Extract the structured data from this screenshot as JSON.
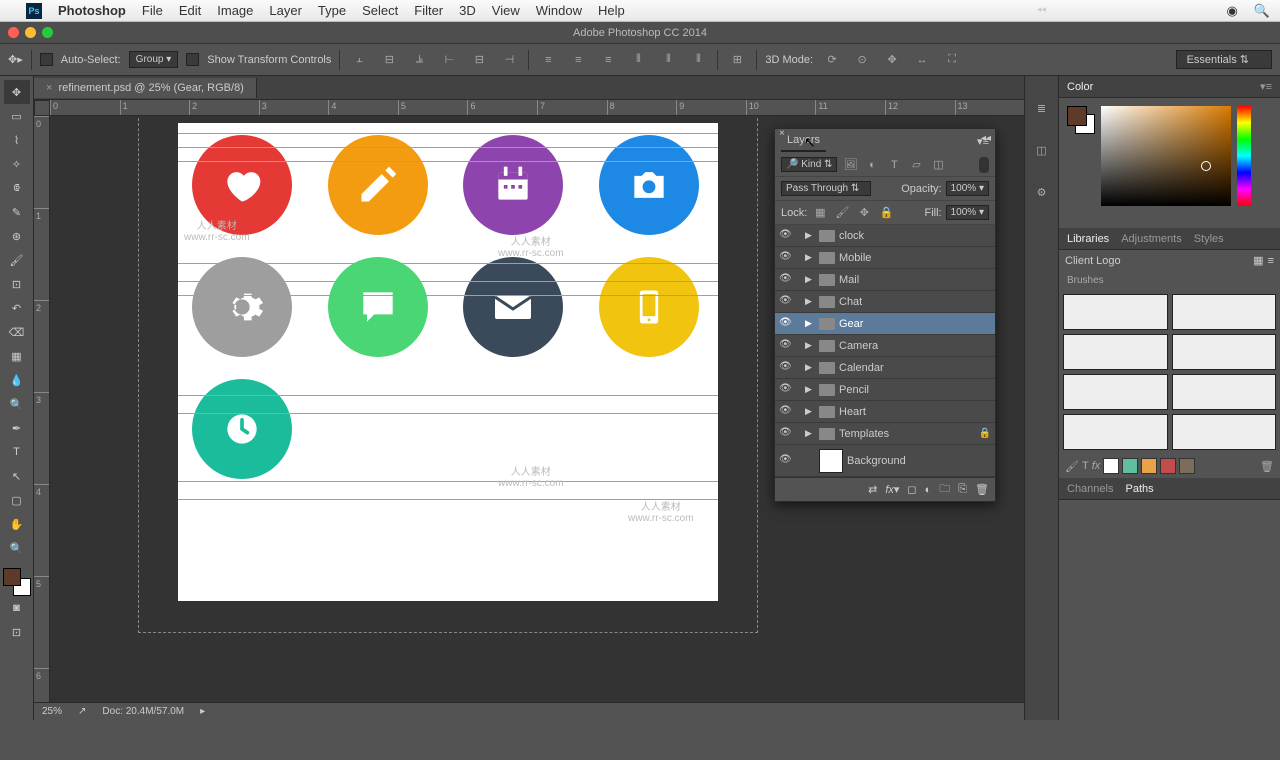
{
  "menubar": {
    "app": "Photoshop",
    "items": [
      "File",
      "Edit",
      "Image",
      "Layer",
      "Type",
      "Select",
      "Filter",
      "3D",
      "View",
      "Window",
      "Help"
    ]
  },
  "app_title": "Adobe Photoshop CC 2014",
  "options_bar": {
    "auto_select_label": "Auto-Select:",
    "auto_select_value": "Group",
    "show_transform_label": "Show Transform Controls",
    "mode3d_label": "3D Mode:"
  },
  "workspace_selector": "Essentials",
  "doc_tab": "refinement.psd @ 25% (Gear, RGB/8)",
  "ruler_h": [
    "0",
    "1",
    "2",
    "3",
    "4",
    "5",
    "6",
    "7",
    "8",
    "9",
    "10",
    "11",
    "12",
    "13"
  ],
  "ruler_v": [
    "0",
    "1",
    "2",
    "3",
    "4",
    "5",
    "6"
  ],
  "watermark": {
    "cn": "人人素材",
    "url": "www.rr-sc.com"
  },
  "layers_panel": {
    "title": "Layers",
    "filter_label": "Kind",
    "blend_mode": "Pass Through",
    "opacity_label": "Opacity:",
    "opacity_value": "100%",
    "lock_label": "Lock:",
    "fill_label": "Fill:",
    "fill_value": "100%",
    "layers": [
      {
        "name": "clock",
        "selected": false
      },
      {
        "name": "Mobile",
        "selected": false
      },
      {
        "name": "Mail",
        "selected": false
      },
      {
        "name": "Chat",
        "selected": false
      },
      {
        "name": "Gear",
        "selected": true
      },
      {
        "name": "Camera",
        "selected": false
      },
      {
        "name": "Calendar",
        "selected": false
      },
      {
        "name": "Pencil",
        "selected": false
      },
      {
        "name": "Heart",
        "selected": false
      },
      {
        "name": "Templates",
        "selected": false,
        "locked": true
      }
    ],
    "background_layer": "Background"
  },
  "right_panels": {
    "color": "Color",
    "libraries": "Libraries",
    "adjustments": "Adjustments",
    "styles": "Styles",
    "library_selected": "Client Logo",
    "brushes_label": "Brushes",
    "channels": "Channels",
    "paths": "Paths"
  },
  "statusbar": {
    "zoom": "25%",
    "doc_info": "Doc: 20.4M/57.0M"
  },
  "icons": {
    "heart": "#e53935",
    "pencil": "#f39c12",
    "calendar": "#8e44ad",
    "camera": "#1e88e5",
    "gear": "#9e9e9e",
    "chat": "#4bd676",
    "mail": "#3a4a5a",
    "mobile": "#f1c40f",
    "clock": "#1abc9c"
  },
  "swatches": [
    "#ffffff",
    "#000000",
    "#808080",
    "#5fbf9f",
    "#e8a24a",
    "#c34d4d",
    "#7a6e5a"
  ]
}
